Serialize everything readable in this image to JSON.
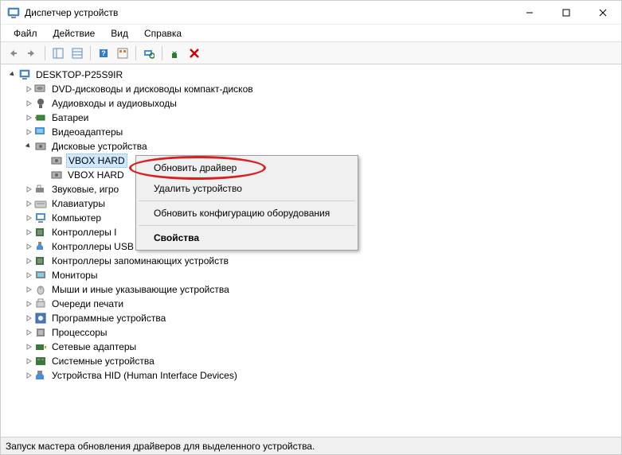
{
  "window": {
    "title": "Диспетчер устройств"
  },
  "menubar": {
    "file": "Файл",
    "action": "Действие",
    "view": "Вид",
    "help": "Справка"
  },
  "tree": {
    "root": "DESKTOP-P25S9IR",
    "categories": [
      "DVD-дисководы и дисководы компакт-дисков",
      "Аудиовходы и аудиовыходы",
      "Батареи",
      "Видеоадаптеры",
      "Дисковые устройства",
      "Звуковые, игро",
      "Клавиатуры",
      "Компьютер",
      "Контроллеры I",
      "Контроллеры USB",
      "Контроллеры запоминающих устройств",
      "Мониторы",
      "Мыши и иные указывающие устройства",
      "Очереди печати",
      "Программные устройства",
      "Процессоры",
      "Сетевые адаптеры",
      "Системные устройства",
      "Устройства HID (Human Interface Devices)"
    ],
    "disk_child1": "VBOX HARD",
    "disk_child2": "VBOX HARD"
  },
  "context_menu": {
    "update_driver": "Обновить драйвер",
    "remove_device": "Удалить устройство",
    "scan_hardware": "Обновить конфигурацию оборудования",
    "properties": "Свойства"
  },
  "statusbar": {
    "text": "Запуск мастера обновления драйверов для выделенного устройства."
  }
}
